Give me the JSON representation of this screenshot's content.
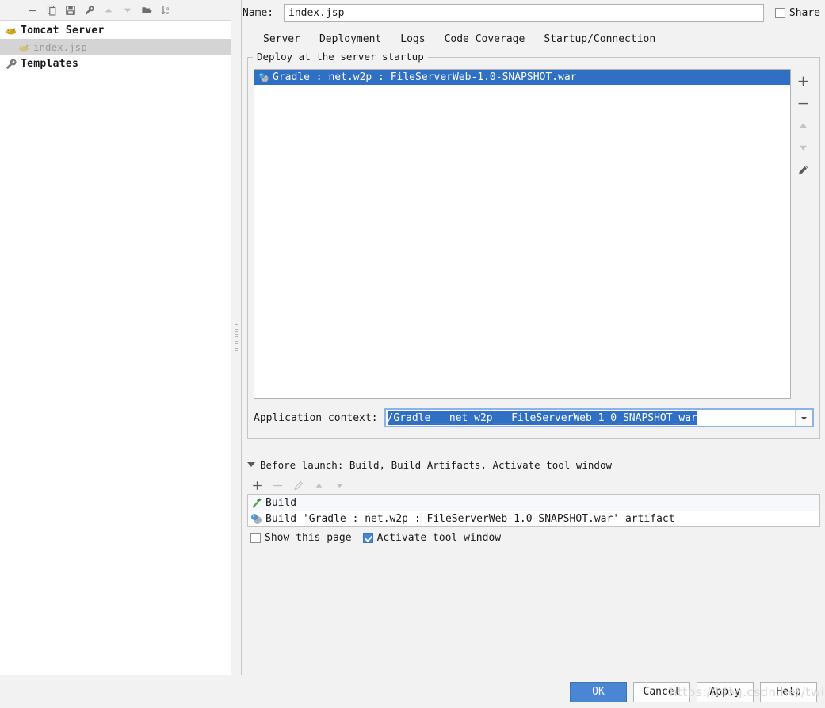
{
  "colors": {
    "accent": "#3d7dca",
    "selection": "#2f6fc4",
    "primary_button": "#4a86d4",
    "panel_bg": "#f2f2f2",
    "field_bg": "#ffffff",
    "tree_selected_bg": "#d4d4d4",
    "focus_border": "#8ab4e8"
  },
  "left_panel": {
    "toolbar": [
      {
        "name": "remove-icon",
        "glyph": "minus"
      },
      {
        "name": "copy-configuration-icon",
        "glyph": "copy"
      },
      {
        "name": "save-configuration-icon",
        "glyph": "save"
      },
      {
        "name": "edit-templates-icon",
        "glyph": "wrench"
      },
      {
        "name": "move-up-icon",
        "glyph": "up"
      },
      {
        "name": "move-down-icon",
        "glyph": "down"
      },
      {
        "name": "new-folder-icon",
        "glyph": "folder-plus"
      },
      {
        "name": "sort-alphabetically-icon",
        "glyph": "sort-az"
      }
    ],
    "tree": [
      {
        "label": "Tomcat Server",
        "icon": "tomcat-icon",
        "level": 0,
        "selected": false,
        "bold": true
      },
      {
        "label": "index.jsp",
        "icon": "tomcat-icon",
        "level": 1,
        "selected": true,
        "bold": false
      },
      {
        "label": "Templates",
        "icon": "wrench-icon",
        "level": 0,
        "selected": false,
        "bold": true
      }
    ]
  },
  "header": {
    "name_label": "Name:",
    "name_value": "index.jsp",
    "name_placeholder": "",
    "share_label_mnemonic": "S",
    "share_label_rest": "hare",
    "share_checked": false
  },
  "tabs": [
    {
      "label": "Server",
      "active": false
    },
    {
      "label": "Deployment",
      "active": true
    },
    {
      "label": "Logs",
      "active": false
    },
    {
      "label": "Code Coverage",
      "active": false
    },
    {
      "label": "Startup/Connection",
      "active": false
    }
  ],
  "deployment": {
    "group_title": "Deploy at the server startup",
    "artifacts": [
      {
        "label": "Gradle : net.w2p : FileServerWeb-1.0-SNAPSHOT.war",
        "icon": "artifact-icon",
        "selected": true
      }
    ],
    "side_buttons": [
      {
        "name": "add-artifact-button",
        "glyph": "plus",
        "enabled": true
      },
      {
        "name": "remove-artifact-button",
        "glyph": "minus",
        "enabled": true
      },
      {
        "name": "move-artifact-up-button",
        "glyph": "up",
        "enabled": false
      },
      {
        "name": "move-artifact-down-button",
        "glyph": "down",
        "enabled": false
      },
      {
        "name": "edit-artifact-button",
        "glyph": "pencil",
        "enabled": true
      }
    ],
    "context_label": "Application context:",
    "context_value": "/Gradle___net_w2p___FileServerWeb_1_0_SNAPSHOT_war",
    "context_selected": true
  },
  "before_launch": {
    "title": "Before launch: Build, Build Artifacts, Activate tool window",
    "toolbar": [
      {
        "name": "add-task-button",
        "glyph": "plus",
        "enabled": true
      },
      {
        "name": "remove-task-button",
        "glyph": "minus",
        "enabled": false
      },
      {
        "name": "edit-task-button",
        "glyph": "pencil",
        "enabled": false
      },
      {
        "name": "move-task-up-button",
        "glyph": "up",
        "enabled": false
      },
      {
        "name": "move-task-down-button",
        "glyph": "down",
        "enabled": false
      }
    ],
    "tasks": [
      {
        "label": "Build",
        "icon": "build-hammer-icon"
      },
      {
        "label": "Build 'Gradle : net.w2p : FileServerWeb-1.0-SNAPSHOT.war' artifact",
        "icon": "artifact-icon"
      }
    ],
    "show_page_label": "Show this page",
    "show_page_checked": false,
    "activate_tool_window_label": "Activate tool window",
    "activate_tool_window_checked": true
  },
  "buttons": {
    "ok": "OK",
    "cancel": "Cancel",
    "apply": "Apply",
    "help": "Help"
  },
  "watermark": {
    "text": "https://blog.csdn.net/twilight"
  }
}
